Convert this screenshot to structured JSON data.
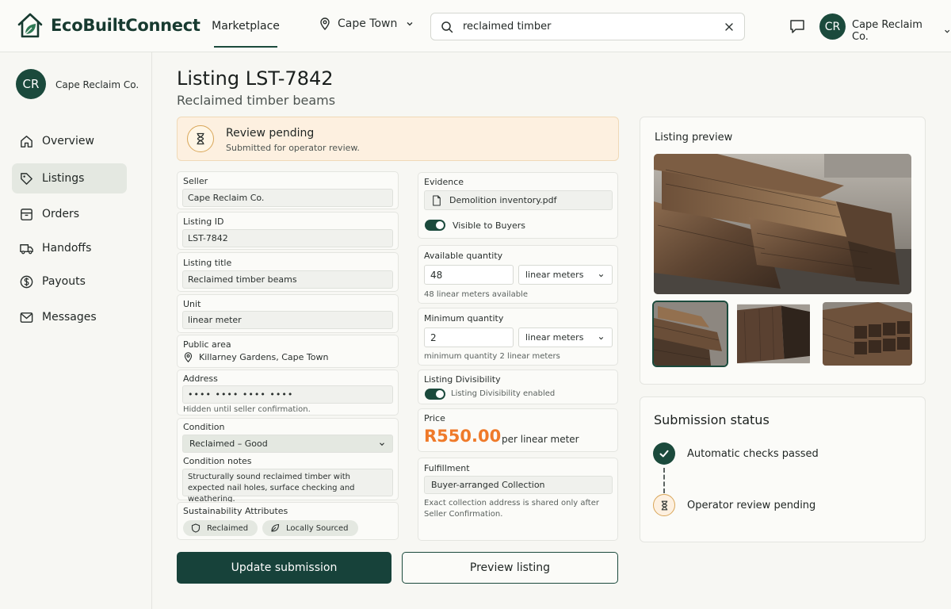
{
  "header": {
    "brand": "EcoBuiltConnect",
    "nav_marketplace": "Marketplace",
    "location": "Cape Town",
    "search_value": "reclaimed timber",
    "avatar_initials": "CR",
    "account_name": "Cape Reclaim Co."
  },
  "sidebar": {
    "avatar_initials": "CR",
    "org_name": "Cape Reclaim Co.",
    "items": [
      {
        "label": "Overview",
        "icon": "home-icon"
      },
      {
        "label": "Listings",
        "icon": "tag-icon",
        "active": true
      },
      {
        "label": "Orders",
        "icon": "box-icon"
      },
      {
        "label": "Handoffs",
        "icon": "truck-icon"
      },
      {
        "label": "Payouts",
        "icon": "dollar-icon"
      },
      {
        "label": "Messages",
        "icon": "mail-icon"
      }
    ]
  },
  "page": {
    "title": "Listing LST-7842",
    "subtitle": "Reclaimed timber beams"
  },
  "banner": {
    "title": "Review pending",
    "subtitle": "Submitted for operator review."
  },
  "form": {
    "seller_label": "Seller",
    "seller_value": "Cape Reclaim Co.",
    "listing_id_label": "Listing ID",
    "listing_id_value": "LST-7842",
    "listing_title_label": "Listing title",
    "listing_title_value": "Reclaimed timber beams",
    "unit_label": "Unit",
    "unit_value": "linear meter",
    "public_area_label": "Public area",
    "public_area_value": "Killarney Gardens, Cape Town",
    "address_label": "Address",
    "address_value": "•••• •••• •••• ••••",
    "address_helper": "Hidden until seller confirmation.",
    "condition_label": "Condition",
    "condition_value": "Reclaimed – Good",
    "condition_notes_label": "Condition notes",
    "condition_notes_value": "Structurally sound reclaimed timber with expected nail holes, surface checking and weathering.",
    "sustainability_label": "Sustainability Attributes",
    "attributes": [
      "Reclaimed",
      "Locally Sourced"
    ],
    "evidence_label": "Evidence",
    "evidence_file": "Demolition inventory.pdf",
    "visible_label": "Visible to Buyers",
    "available_label": "Available quantity",
    "available_value": "48",
    "available_unit": "linear meters",
    "available_helper": "48 linear meters available",
    "minimum_label": "Minimum quantity",
    "minimum_value": "2",
    "minimum_unit": "linear meters",
    "minimum_helper": "minimum quantity 2 linear meters",
    "divisibility_label": "Listing Divisibility",
    "divisibility_value": "Listing Divisibility enabled",
    "price_label": "Price",
    "price_value": "R550.00",
    "price_unit": "per linear meter",
    "fulfillment_label": "Fulfillment",
    "fulfillment_value": "Buyer-arranged Collection",
    "fulfillment_helper_1": "Exact collection address is shared only after",
    "fulfillment_helper_2": "Seller Confirmation."
  },
  "actions": {
    "update": "Update submission",
    "preview": "Preview listing"
  },
  "preview_panel": {
    "title": "Listing preview"
  },
  "status_panel": {
    "title": "Submission status",
    "steps": [
      "Automatic checks passed",
      "Operator review pending"
    ]
  },
  "colors": {
    "brand": "#1b4a3c",
    "accent_price": "#ef7a2a",
    "banner_bg": "#fdf0e0"
  }
}
